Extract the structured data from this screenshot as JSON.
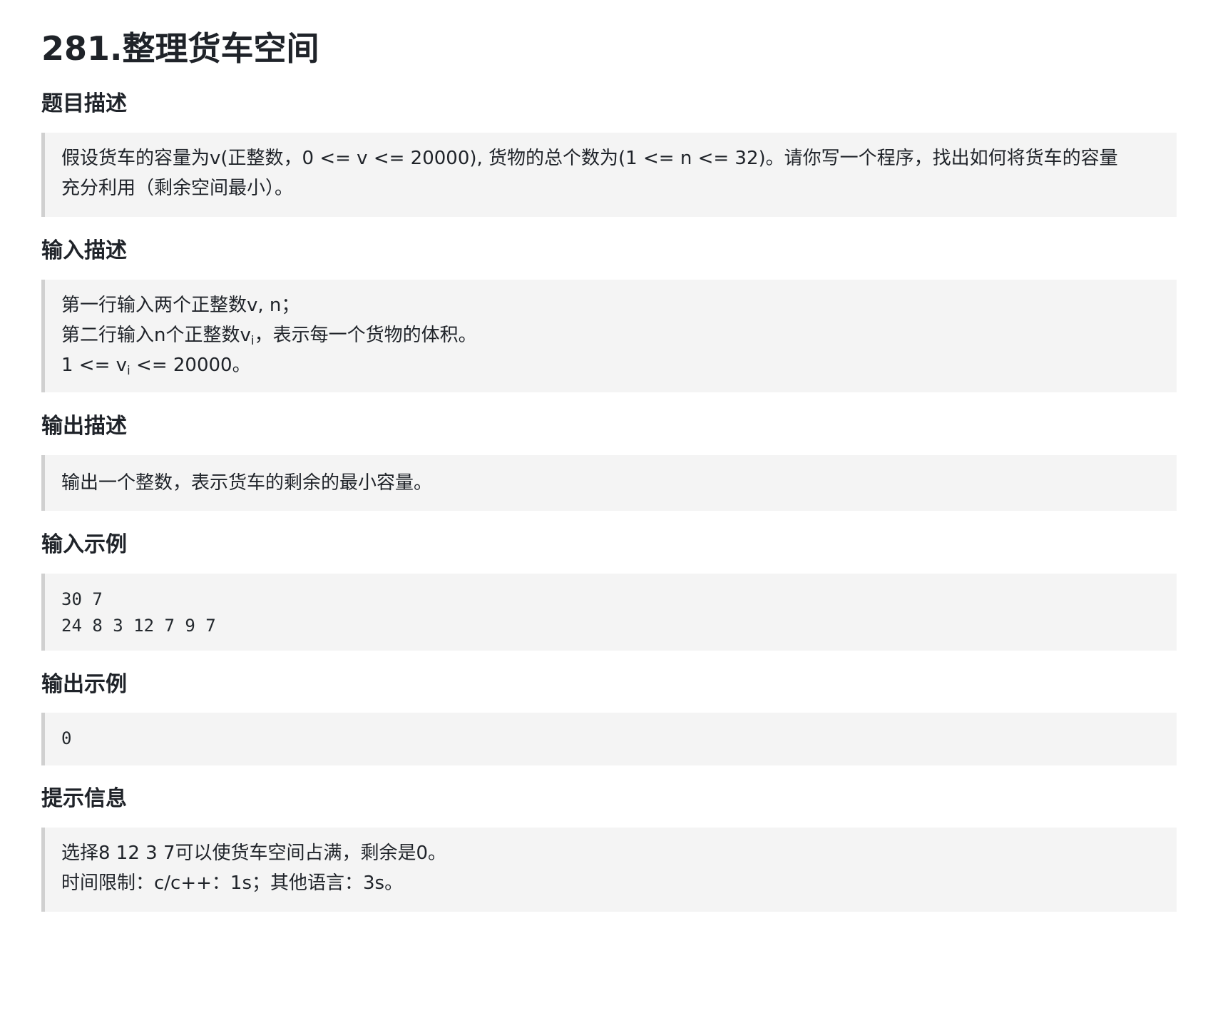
{
  "title": "281.整理货车空间",
  "sections": {
    "description": {
      "heading": "题目描述",
      "lines": [
        "假设货车的容量为v(正整数，0 <= v <= 20000), 货物的总个数为(1 <= n <= 32)。请你写一个程序，找出如何将货车的容量",
        "充分利用（剩余空间最小）。"
      ]
    },
    "input_desc": {
      "heading": "输入描述",
      "line1": "第一行输入两个正整数v, n；",
      "line2_pre": "第二行输入n个正整数v",
      "line2_sub": "i",
      "line2_post": "，表示每一个货物的体积。",
      "line3_pre": "1 <= v",
      "line3_sub": "i",
      "line3_post": " <= 20000。"
    },
    "output_desc": {
      "heading": "输出描述",
      "lines": [
        "输出一个整数，表示货车的剩余的最小容量。"
      ]
    },
    "input_example": {
      "heading": "输入示例",
      "lines": [
        "30 7",
        "24 8 3 12 7 9 7"
      ]
    },
    "output_example": {
      "heading": "输出示例",
      "lines": [
        "0"
      ]
    },
    "hint": {
      "heading": "提示信息",
      "lines": [
        "选择8 12 3 7可以使货车空间占满，剩余是0。",
        "时间限制：c/c++：1s；其他语言：3s。"
      ]
    }
  }
}
